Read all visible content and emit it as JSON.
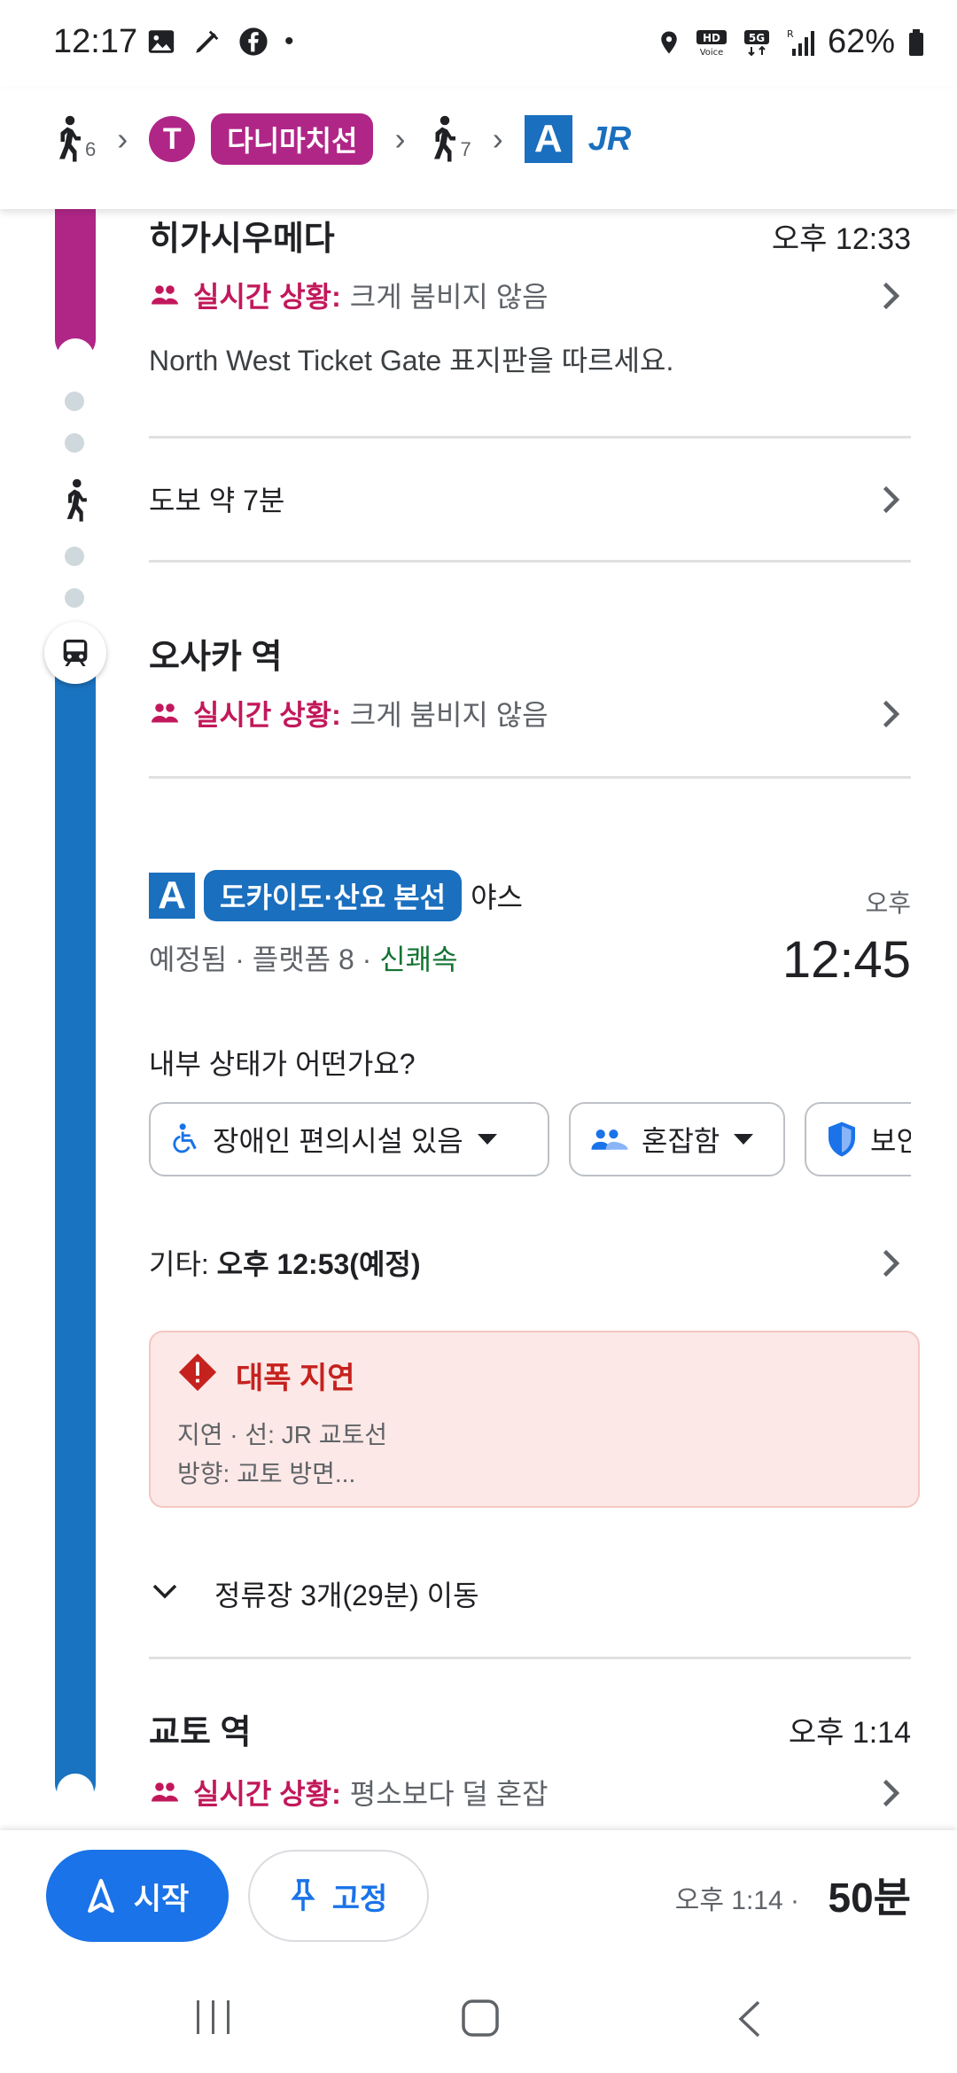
{
  "status_bar": {
    "time": "12:17",
    "battery": "62%"
  },
  "route_header": {
    "walk1_minutes": "6",
    "transit_letter": "T",
    "transit_line": "다니마치선",
    "walk2_minutes": "7",
    "rail_letter": "A",
    "rail_brand": "JR"
  },
  "stop_higashi": {
    "name": "히가시우메다",
    "time": "오후 12:33",
    "realtime_label": "실시간 상황:",
    "realtime_value": "크게 붐비지 않음",
    "instruction": "North West Ticket Gate 표지판을 따르세요."
  },
  "walk": {
    "label": "도보 약 7분"
  },
  "stop_osaka": {
    "name": "오사카 역",
    "realtime_label": "실시간 상황:",
    "realtime_value": "크게 붐비지 않음"
  },
  "train": {
    "letter": "A",
    "line": "도카이도·산요 본선",
    "destination": "야스",
    "ampm": "오후",
    "departure": "12:45",
    "status": "예정됨 · 플랫폼 8 · ",
    "service": "신쾌속"
  },
  "crowd_question": "내부 상태가 어떤가요?",
  "chips": {
    "accessibility": "장애인 편의시설 있음",
    "crowded": "혼잡함",
    "security": "보안"
  },
  "other": {
    "prefix": "기타: ",
    "value": "오후 12:53(예정)"
  },
  "alert": {
    "title": "대폭 지연",
    "line1": "지연 · 선: JR 교토선",
    "line2": "방향: 교토 방면..."
  },
  "stops_summary": "정류장 3개(29분) 이동",
  "stop_kyoto": {
    "name": "교토 역",
    "time": "오후 1:14",
    "realtime_label": "실시간 상황:",
    "realtime_value": "평소보다 덜 혼잡"
  },
  "bottom_bar": {
    "start_label": "시작",
    "pin_label": "고정",
    "arrival": "오후 1:14 ·",
    "duration": "50분"
  },
  "colors": {
    "magenta_line": "#b02687",
    "blue_line": "#1a73c0",
    "primary_button": "#1a73e8",
    "alert_bg": "#fce8e6",
    "alert_text": "#c5221f"
  }
}
